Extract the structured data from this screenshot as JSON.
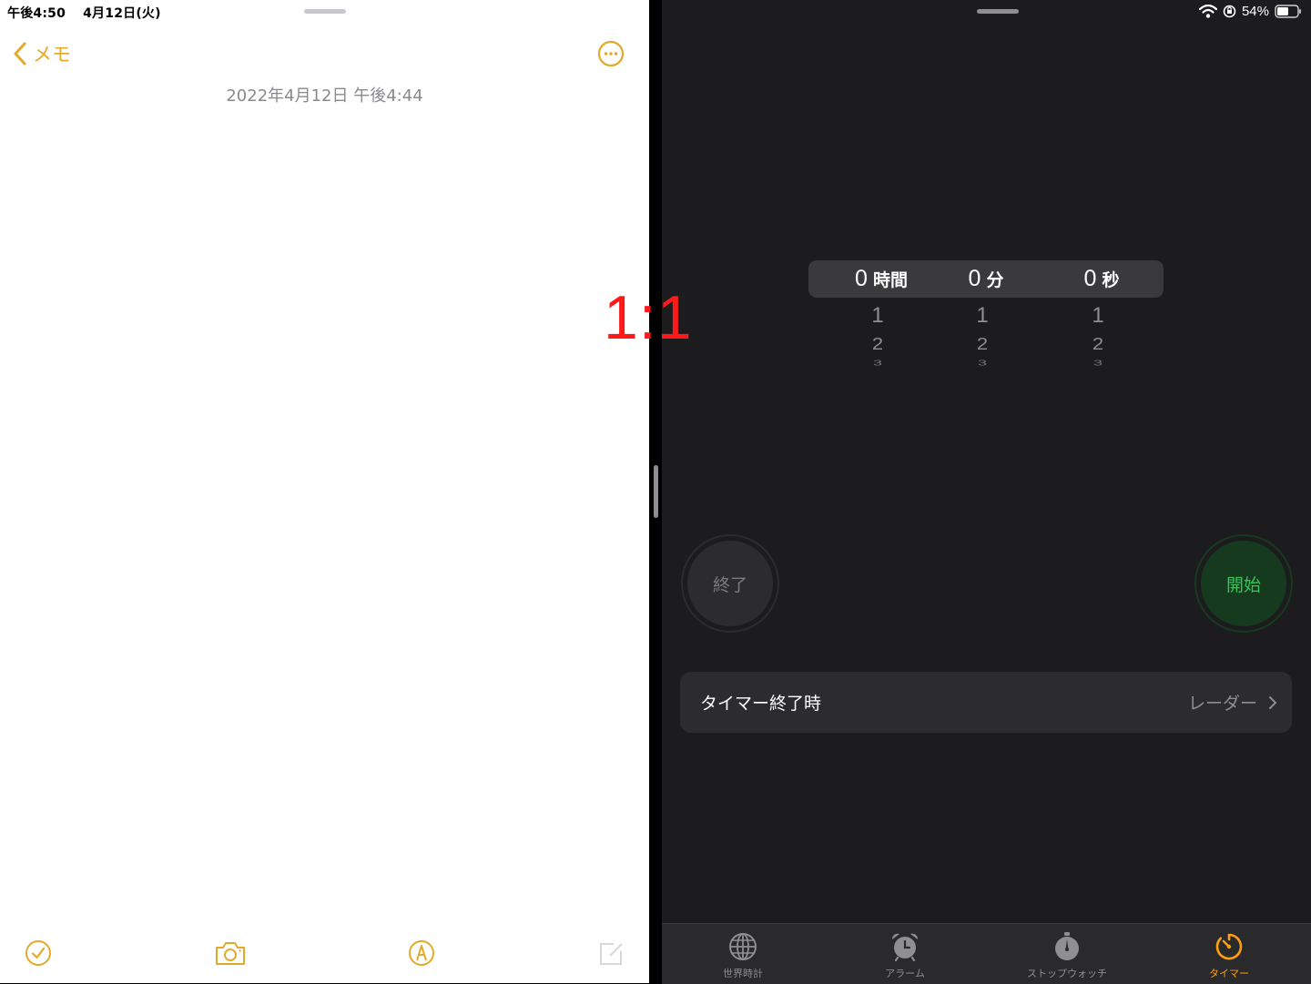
{
  "notes": {
    "status_time": "午後4:50",
    "status_date": "4月12日(火)",
    "back_label": "メモ",
    "note_date": "2022年4月12日 午後4:44",
    "accent_color": "#e2aa2a",
    "toolbar_icons": [
      "checklist-icon",
      "camera-icon",
      "markup-icon",
      "compose-icon"
    ]
  },
  "overlay": {
    "ratio_label": "1:1"
  },
  "clock": {
    "status": {
      "battery_percent": "54%",
      "battery_level": 0.54
    },
    "picker": {
      "columns": [
        {
          "value": "0",
          "unit": "時間",
          "next": [
            "1",
            "2",
            "3"
          ]
        },
        {
          "value": "0",
          "unit": "分",
          "next": [
            "1",
            "2",
            "3"
          ]
        },
        {
          "value": "0",
          "unit": "秒",
          "next": [
            "1",
            "2",
            "3"
          ]
        }
      ]
    },
    "buttons": {
      "cancel_label": "終了",
      "start_label": "開始",
      "start_color": "#33c759"
    },
    "when_ends": {
      "label": "タイマー終了時",
      "value": "レーダー"
    },
    "tabs": [
      {
        "label": "世界時計",
        "icon": "globe-icon",
        "active": false
      },
      {
        "label": "アラーム",
        "icon": "alarm-clock-icon",
        "active": false
      },
      {
        "label": "ストップウォッチ",
        "icon": "stopwatch-icon",
        "active": false
      },
      {
        "label": "タイマー",
        "icon": "timer-icon",
        "active": true
      }
    ],
    "active_color": "#ff9f0a"
  }
}
